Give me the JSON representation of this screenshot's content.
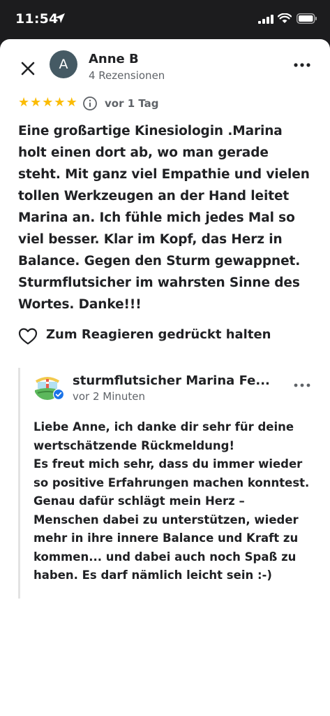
{
  "status_bar": {
    "time": "11:54"
  },
  "review": {
    "reviewer_initial": "A",
    "reviewer_name": "Anne B",
    "reviewer_meta": "4 Rezensionen",
    "rating": 5,
    "stars": [
      "★",
      "★",
      "★",
      "★",
      "★"
    ],
    "date": "vor 1 Tag",
    "text": "Eine großartige Kinesiologin .Marina holt einen dort ab, wo man gerade steht. Mit ganz viel Empathie und vielen tollen Werkzeugen an der Hand leitet Marina an. Ich fühle mich jedes Mal so viel besser. Klar im Kopf, das Herz in Balance. Gegen den Sturm gewappnet. Sturmflutsicher im wahrsten Sinne des Wortes. Danke!!!",
    "react_label": "Zum Reagieren gedrückt halten"
  },
  "reply": {
    "owner_name": "sturmflutsicher Marina Fe...",
    "time": "vor 2 Minuten",
    "text": "Liebe Anne, ich danke dir sehr für deine wertschätzende Rückmeldung!\nEs freut mich sehr, dass du immer wieder so positive Erfahrungen machen konntest. Genau dafür schlägt mein Herz – Menschen dabei zu unterstützen, wieder mehr in ihre innere Balance und Kraft zu kommen... und dabei auch noch Spaß zu haben. Es darf nämlich leicht sein :-)"
  },
  "colors": {
    "star": "#fbbc04",
    "avatar_bg": "#455a64",
    "verified": "#1a73e8",
    "secondary_text": "#5f6368"
  },
  "icons": [
    "close-icon",
    "more-icon",
    "info-icon",
    "heart-icon",
    "verified-icon",
    "location-arrow-icon",
    "signal-icon",
    "wifi-icon",
    "battery-icon"
  ]
}
